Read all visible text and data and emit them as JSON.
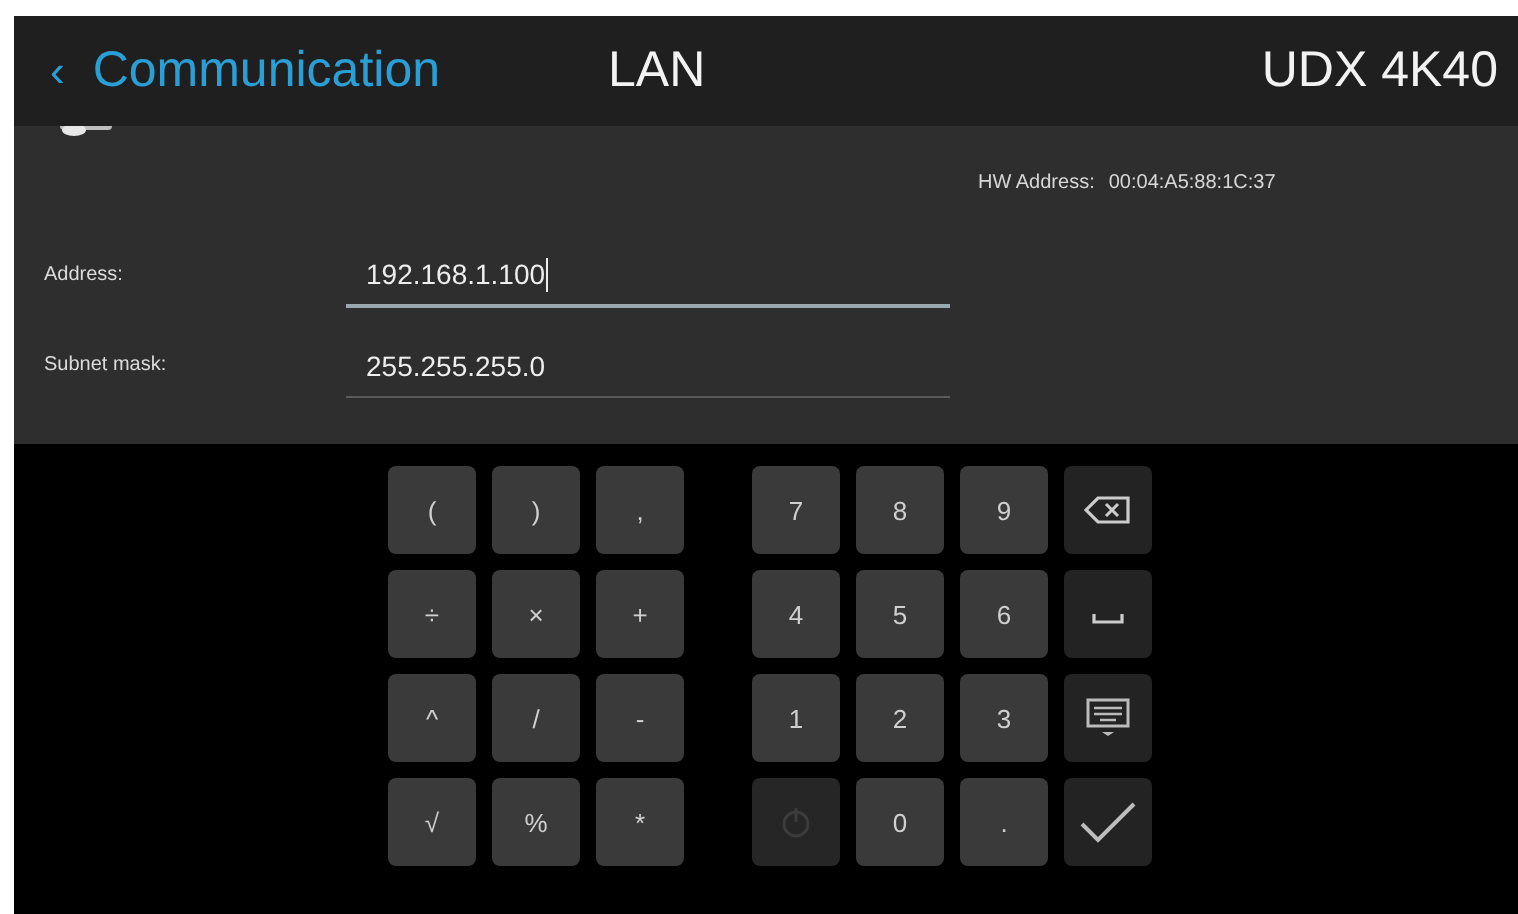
{
  "header": {
    "back_label": "Communication",
    "back_icon": "‹",
    "title": "LAN",
    "device": "UDX 4K40"
  },
  "hw_address": {
    "label": "HW Address:",
    "value": "00:04:A5:88:1C:37"
  },
  "fields": [
    {
      "label": "Address:",
      "value": "192.168.1.100",
      "focused": true
    },
    {
      "label": "Subnet mask:",
      "value": "255.255.255.0",
      "focused": false
    }
  ],
  "keypad": {
    "groups": [
      {
        "keys": [
          {
            "kind": "char",
            "label": "("
          },
          {
            "kind": "char",
            "label": ")"
          },
          {
            "kind": "char",
            "label": ","
          },
          {
            "kind": "char",
            "label": "÷"
          },
          {
            "kind": "char",
            "label": "×"
          },
          {
            "kind": "char",
            "label": "+"
          },
          {
            "kind": "char",
            "label": "^"
          },
          {
            "kind": "char",
            "label": "/"
          },
          {
            "kind": "char",
            "label": "-"
          },
          {
            "kind": "char",
            "label": "√"
          },
          {
            "kind": "char",
            "label": "%"
          },
          {
            "kind": "char",
            "label": "*"
          }
        ]
      },
      {
        "keys": [
          {
            "kind": "char",
            "label": "7"
          },
          {
            "kind": "char",
            "label": "8"
          },
          {
            "kind": "char",
            "label": "9"
          },
          {
            "kind": "backspace"
          },
          {
            "kind": "char",
            "label": "4"
          },
          {
            "kind": "char",
            "label": "5"
          },
          {
            "kind": "char",
            "label": "6"
          },
          {
            "kind": "space"
          },
          {
            "kind": "char",
            "label": "1"
          },
          {
            "kind": "char",
            "label": "2"
          },
          {
            "kind": "char",
            "label": "3"
          },
          {
            "kind": "hide"
          },
          {
            "kind": "inactive"
          },
          {
            "kind": "char",
            "label": "0"
          },
          {
            "kind": "char",
            "label": "."
          },
          {
            "kind": "done"
          }
        ]
      }
    ]
  }
}
